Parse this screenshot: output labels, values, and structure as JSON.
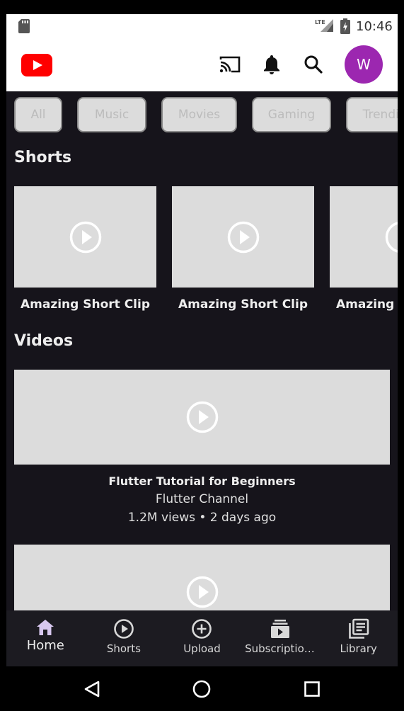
{
  "status_bar": {
    "time": "10:46",
    "network": "LTE"
  },
  "app_bar": {
    "avatar_letter": "W"
  },
  "chips": [
    "All",
    "Music",
    "Movies",
    "Gaming",
    "Trending"
  ],
  "shorts": {
    "title": "Shorts",
    "items": [
      {
        "title": "Amazing Short Clip"
      },
      {
        "title": "Amazing Short Clip"
      },
      {
        "title": "Amazing Short Clip"
      }
    ]
  },
  "videos": {
    "title": "Videos",
    "items": [
      {
        "title": "Flutter Tutorial for Beginners",
        "channel": "Flutter Channel",
        "meta": "1.2M views • 2 days ago"
      }
    ]
  },
  "bottom_nav": {
    "items": [
      {
        "label": "Home",
        "icon": "home-icon",
        "active": true
      },
      {
        "label": "Shorts",
        "icon": "play-circle-icon",
        "active": false
      },
      {
        "label": "Upload",
        "icon": "add-circle-icon",
        "active": false
      },
      {
        "label": "Subscriptions",
        "icon": "subscriptions-icon",
        "active": false
      },
      {
        "label": "Library",
        "icon": "library-icon",
        "active": false
      }
    ]
  },
  "colors": {
    "background": "#16141b",
    "accent_avatar": "#9c27b0",
    "youtube_red": "#ff0000",
    "nav_active": "#d8c8f0"
  }
}
